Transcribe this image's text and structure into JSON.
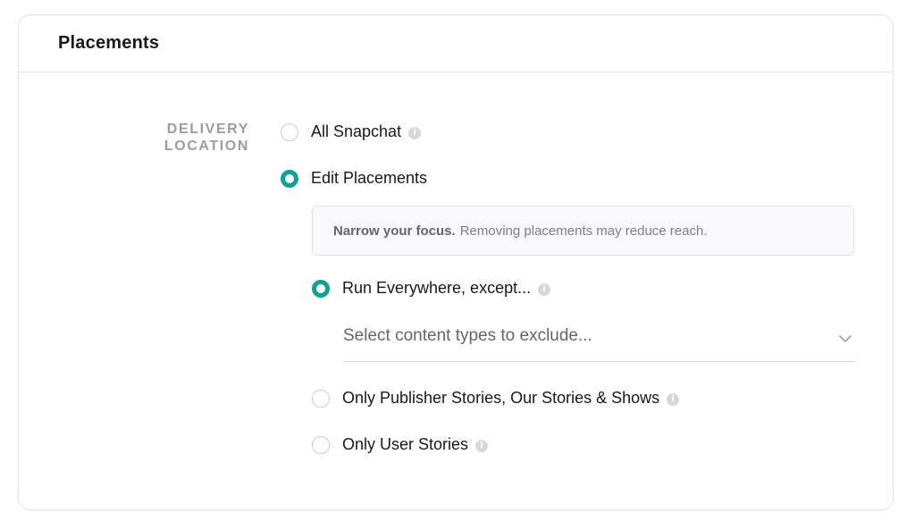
{
  "header": {
    "title": "Placements"
  },
  "delivery": {
    "label_line1": "DELIVERY",
    "label_line2": "LOCATION",
    "options": [
      {
        "label": "All Snapchat",
        "checked": false,
        "info_icon": "info-icon"
      },
      {
        "label": "Edit Placements",
        "checked": true
      }
    ]
  },
  "notice": {
    "bold": "Narrow your focus.",
    "text": "Removing placements may reduce reach."
  },
  "placement_options": [
    {
      "label": "Run Everywhere, except...",
      "checked": true,
      "info_icon": "info-icon"
    },
    {
      "label": "Only Publisher Stories, Our Stories & Shows",
      "checked": false,
      "info_icon": "info-icon"
    },
    {
      "label": "Only User Stories",
      "checked": false,
      "info_icon": "info-icon"
    }
  ],
  "exclude_select": {
    "placeholder": "Select content types to exclude...",
    "icon": "chevron-down-icon"
  },
  "colors": {
    "accent": "#0fa292",
    "border": "#e1e3e6",
    "muted_label": "#9a9ea3"
  }
}
